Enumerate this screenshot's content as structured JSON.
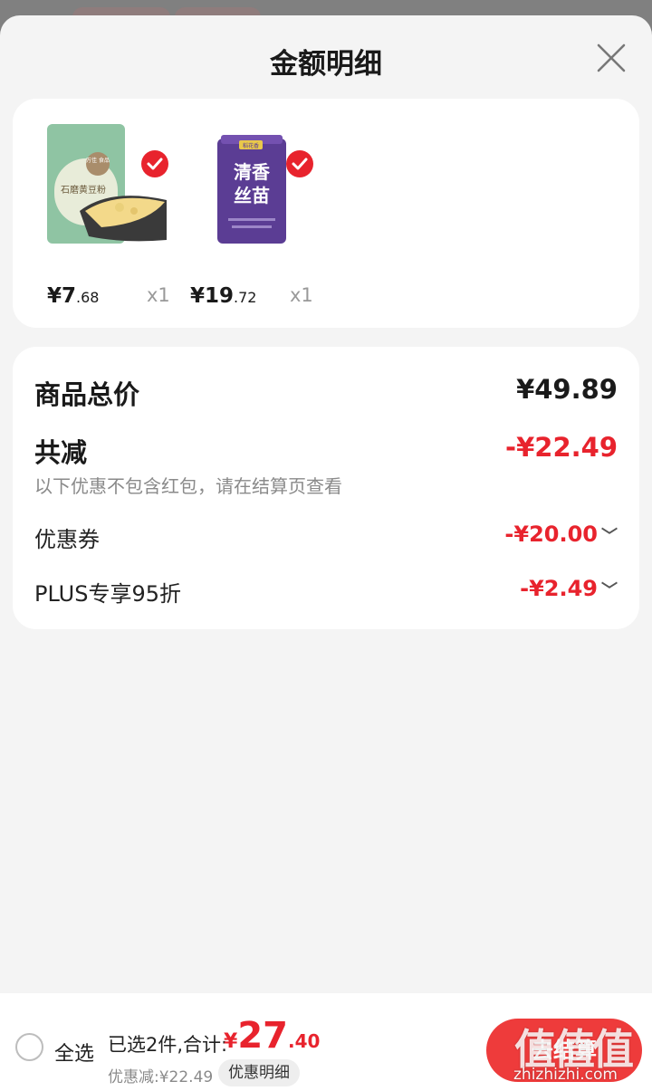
{
  "sheet": {
    "title": "金额明细"
  },
  "products": [
    {
      "name": "石磨黄豆粉",
      "price_int": "¥7",
      "price_dec": ".68",
      "qty": "x1",
      "checked": true
    },
    {
      "name": "清香丝苗",
      "price_int": "¥19",
      "price_dec": ".72",
      "qty": "x1",
      "checked": true
    }
  ],
  "product_images": {
    "p1_brand": "万佳 食品",
    "p1_label": "石磨黄豆粉",
    "p2_brand": "稻花香",
    "p2_line1": "清香",
    "p2_line2": "丝苗"
  },
  "summary": {
    "total_label": "商品总价",
    "total_value": "¥49.89",
    "reduce_label": "共减",
    "reduce_value": "-¥22.49",
    "note": "以下优惠不包含红包，请在结算页查看",
    "coupon_label": "优惠券",
    "coupon_value": "-¥20.00",
    "plus_label": "PLUS专享95折",
    "plus_value": "-¥2.49"
  },
  "bottom_bar": {
    "select_all": "全选",
    "selected_text": "已选2件,合计:",
    "total_symbol": "¥",
    "total_int": "27",
    "total_dec": ".40",
    "discount_text": "优惠减:¥22.49",
    "detail_button": "优惠明细",
    "checkout_button": "去结算"
  },
  "watermark": {
    "logo": "值值值",
    "url": "zhizhizhi.com"
  },
  "colors": {
    "accent": "#e8232d",
    "sheet_bg": "#f4f4f4",
    "overlay": "#7d7d7d"
  }
}
